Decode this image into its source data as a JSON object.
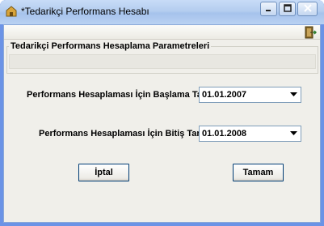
{
  "window": {
    "title": "*Tedarikçi Performans Hesabı"
  },
  "group": {
    "label": "Tedarikçi  Performans Hesaplama Parametreleri"
  },
  "params": {
    "start_label": "Performans Hesaplaması İçin Başlama Tarihi",
    "start_value": "01.01.2007",
    "end_label": "Performans Hesaplaması İçin Bitiş Tarihi",
    "end_value": "01.01.2008"
  },
  "buttons": {
    "cancel_label": "İptal",
    "ok_label": "Tamam"
  },
  "icons": {
    "title": "app-window-icon",
    "toolbar": "exit-door-icon",
    "dropdown": "chevron-down-icon"
  },
  "colors": {
    "titlebar": "#b4cdef",
    "client": "#f0efea",
    "button_border": "#003c74"
  }
}
